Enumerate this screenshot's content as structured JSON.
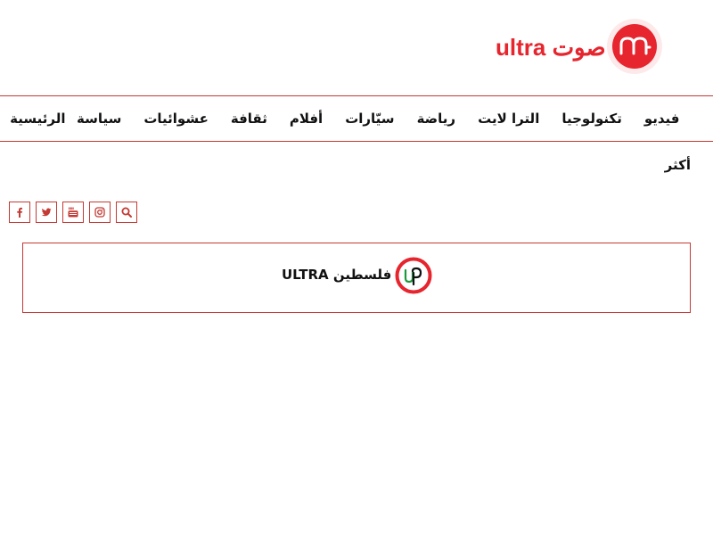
{
  "header": {
    "logo_text": "ultra صوت",
    "logo_icon": "ultra-sawt-logo-icon",
    "brand_color": "#e6252e"
  },
  "nav": {
    "items": [
      {
        "label": "الرئيسية"
      },
      {
        "label": "سياسة"
      },
      {
        "label": "عشوائيات"
      },
      {
        "label": "ثقافة"
      },
      {
        "label": "أفلام"
      },
      {
        "label": "سيّارات"
      },
      {
        "label": "رياضة"
      },
      {
        "label": "الترا لايت"
      },
      {
        "label": "تكنولوجيا"
      },
      {
        "label": "فيديو"
      }
    ],
    "more_label": "أكثر",
    "border_color": "#c43a34"
  },
  "social": {
    "icons": [
      "search-icon",
      "instagram-icon",
      "youtube-icon",
      "twitter-icon",
      "facebook-icon"
    ],
    "accent_color": "#c43a34"
  },
  "promo": {
    "text": "فلسطين ULTRA",
    "icon": "ultra-palestine-logo-icon"
  }
}
